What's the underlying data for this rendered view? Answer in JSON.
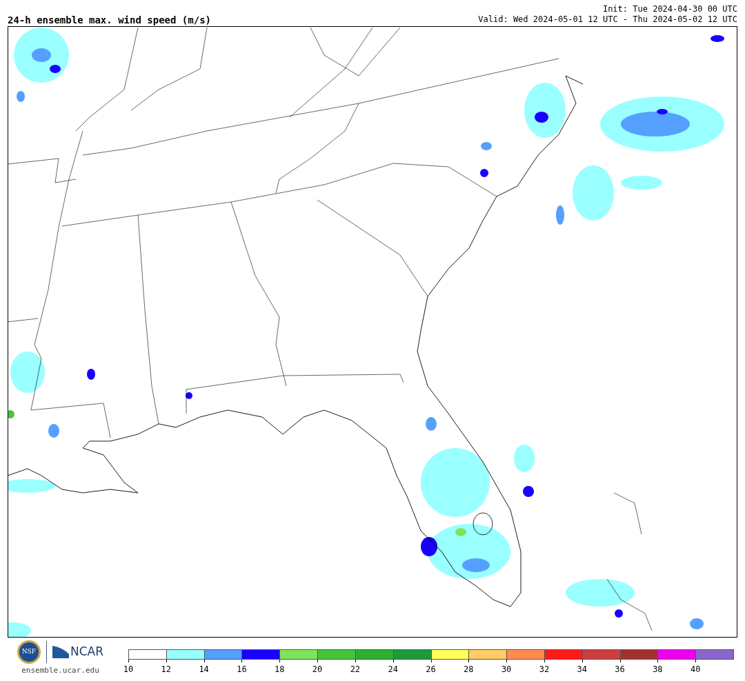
{
  "header": {
    "title": "24-h ensemble max. wind speed (m/s)",
    "init": "Init: Tue 2024-04-30 00 UTC",
    "valid": "Valid: Wed 2024-05-01 12 UTC - Thu 2024-05-02 12 UTC"
  },
  "footer": {
    "nsf_logo": "NSF",
    "ncar_logo": "NCAR",
    "url": "ensemble.ucar.edu"
  },
  "colorbar": {
    "segments": [
      {
        "label": "10",
        "color": "#ffffff"
      },
      {
        "label": "12",
        "color": "#99ffff"
      },
      {
        "label": "14",
        "color": "#55a0ff"
      },
      {
        "label": "16",
        "color": "#1a00ff"
      },
      {
        "label": "18",
        "color": "#7de35a"
      },
      {
        "label": "20",
        "color": "#45c43c"
      },
      {
        "label": "22",
        "color": "#2eb030"
      },
      {
        "label": "24",
        "color": "#1f9a3a"
      },
      {
        "label": "26",
        "color": "#ffff5a"
      },
      {
        "label": "28",
        "color": "#ffcc66"
      },
      {
        "label": "30",
        "color": "#ff8a50"
      },
      {
        "label": "32",
        "color": "#ff1a1a"
      },
      {
        "label": "34",
        "color": "#cc3f3f"
      },
      {
        "label": "36",
        "color": "#a33030"
      },
      {
        "label": "38",
        "color": "#ee00ee"
      },
      {
        "label": "40",
        "color": "#8866cc"
      }
    ]
  }
}
